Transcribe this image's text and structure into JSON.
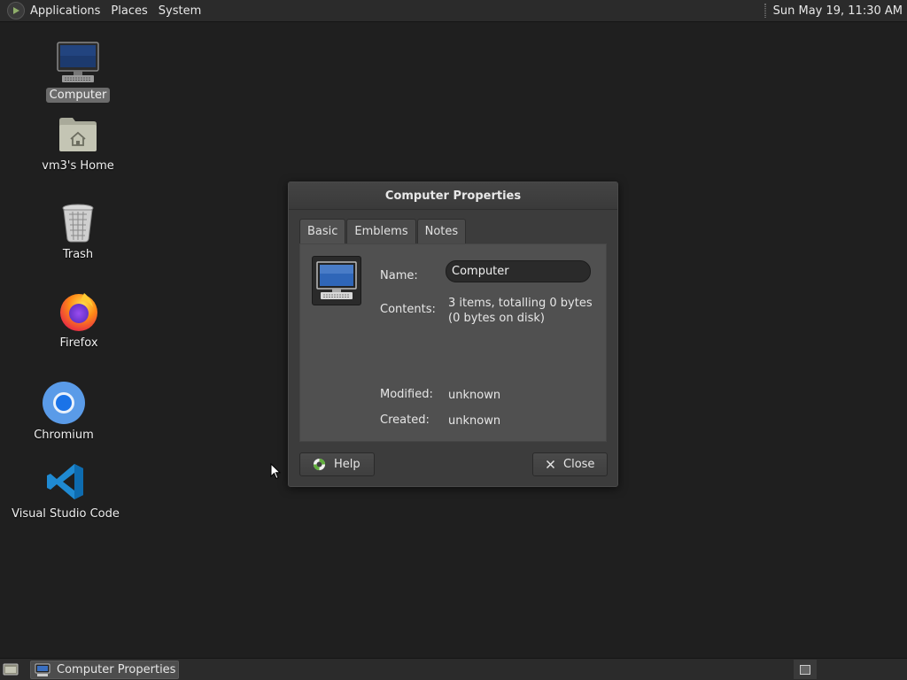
{
  "top_panel": {
    "menus": [
      "Applications",
      "Places",
      "System"
    ],
    "clock": "Sun May 19, 11:30 AM"
  },
  "desktop_icons": [
    {
      "label": "Computer",
      "icon": "computer-icon",
      "selected": true
    },
    {
      "label": "vm3's Home",
      "icon": "home-folder-icon"
    },
    {
      "label": "Trash",
      "icon": "trash-icon"
    },
    {
      "label": "Firefox",
      "icon": "firefox-icon"
    },
    {
      "label": "Chromium",
      "icon": "chromium-icon"
    },
    {
      "label": "Visual Studio Code",
      "icon": "vscode-icon"
    }
  ],
  "dialog": {
    "title": "Computer Properties",
    "tabs": [
      "Basic",
      "Emblems",
      "Notes"
    ],
    "active_tab": "Basic",
    "name_label": "Name:",
    "name_value": "Computer",
    "contents_label": "Contents:",
    "contents_line1": "3 items, totalling 0 bytes",
    "contents_line2": "(0 bytes on disk)",
    "modified_label": "Modified:",
    "modified_value": "unknown",
    "created_label": "Created:",
    "created_value": "unknown",
    "help_label": "Help",
    "close_label": "Close"
  },
  "taskbar": {
    "task_label": "Computer Properties"
  },
  "colors": {
    "desktop_bg": "#1f1f1f",
    "panel_bg": "#2b2b2b",
    "dialog_bg": "#3c3c3c",
    "tab_body_bg": "#505050"
  }
}
